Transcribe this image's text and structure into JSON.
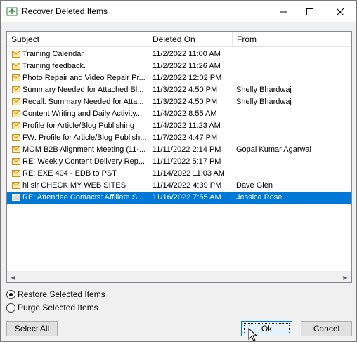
{
  "window": {
    "title": "Recover Deleted Items",
    "icon": "recycle-folder-icon",
    "minimize_icon": "minimize-icon",
    "maximize_icon": "maximize-icon",
    "close_icon": "close-icon"
  },
  "list": {
    "columns": [
      "Subject",
      "Deleted On",
      "From"
    ],
    "rows": [
      {
        "subject": "Training Calendar",
        "deleted_on": "11/2/2022 11:00 AM",
        "from": "",
        "icon": "envelope-icon"
      },
      {
        "subject": "Training feedback.",
        "deleted_on": "11/2/2022 11:26 AM",
        "from": "",
        "icon": "envelope-icon"
      },
      {
        "subject": "Photo Repair and Video Repair Pr...",
        "deleted_on": "11/2/2022 12:02 PM",
        "from": "",
        "icon": "envelope-icon"
      },
      {
        "subject": "Summary Needed for Attached Bl...",
        "deleted_on": "11/3/2022 4:50 PM",
        "from": "Shelly Bhardwaj",
        "icon": "envelope-icon"
      },
      {
        "subject": "Recall: Summary Needed for Atta...",
        "deleted_on": "11/3/2022 4:50 PM",
        "from": "Shelly Bhardwaj",
        "icon": "envelope-icon"
      },
      {
        "subject": "Content Writing and Daily Activity...",
        "deleted_on": "11/4/2022 8:55 AM",
        "from": "",
        "icon": "envelope-icon"
      },
      {
        "subject": "Profile for Article/Blog Publishing",
        "deleted_on": "11/4/2022 11:23 AM",
        "from": "",
        "icon": "envelope-icon"
      },
      {
        "subject": "FW: Profile for Article/Blog Publish...",
        "deleted_on": "11/7/2022 4:47 PM",
        "from": "",
        "icon": "envelope-icon"
      },
      {
        "subject": "MOM B2B Alignment Meeting (11-...",
        "deleted_on": "11/11/2022 2:14 PM",
        "from": "Gopal Kumar Agarwal",
        "icon": "envelope-icon"
      },
      {
        "subject": "RE: Weekly Content Delivery Rep...",
        "deleted_on": "11/11/2022 5:17 PM",
        "from": "",
        "icon": "envelope-icon"
      },
      {
        "subject": "RE: EXE 404 - EDB to PST",
        "deleted_on": "11/14/2022 11:03 AM",
        "from": "",
        "icon": "envelope-icon"
      },
      {
        "subject": "hi sir CHECK MY WEB SITES",
        "deleted_on": "11/14/2022 4:39 PM",
        "from": "Dave Glen",
        "icon": "envelope-icon"
      },
      {
        "subject": "RE: Attendee Contacts: Affiliate S...",
        "deleted_on": "11/16/2022 7:55 AM",
        "from": "Jessica Rose",
        "icon": "envelope-icon",
        "selected": true
      }
    ]
  },
  "options": {
    "restore_label": "Restore Selected Items",
    "purge_label": "Purge Selected Items",
    "selected": "restore"
  },
  "buttons": {
    "select_all": "Select All",
    "ok": "Ok",
    "cancel": "Cancel"
  },
  "colors": {
    "selection": "#0078d7",
    "envelope": "#e8b84a"
  }
}
